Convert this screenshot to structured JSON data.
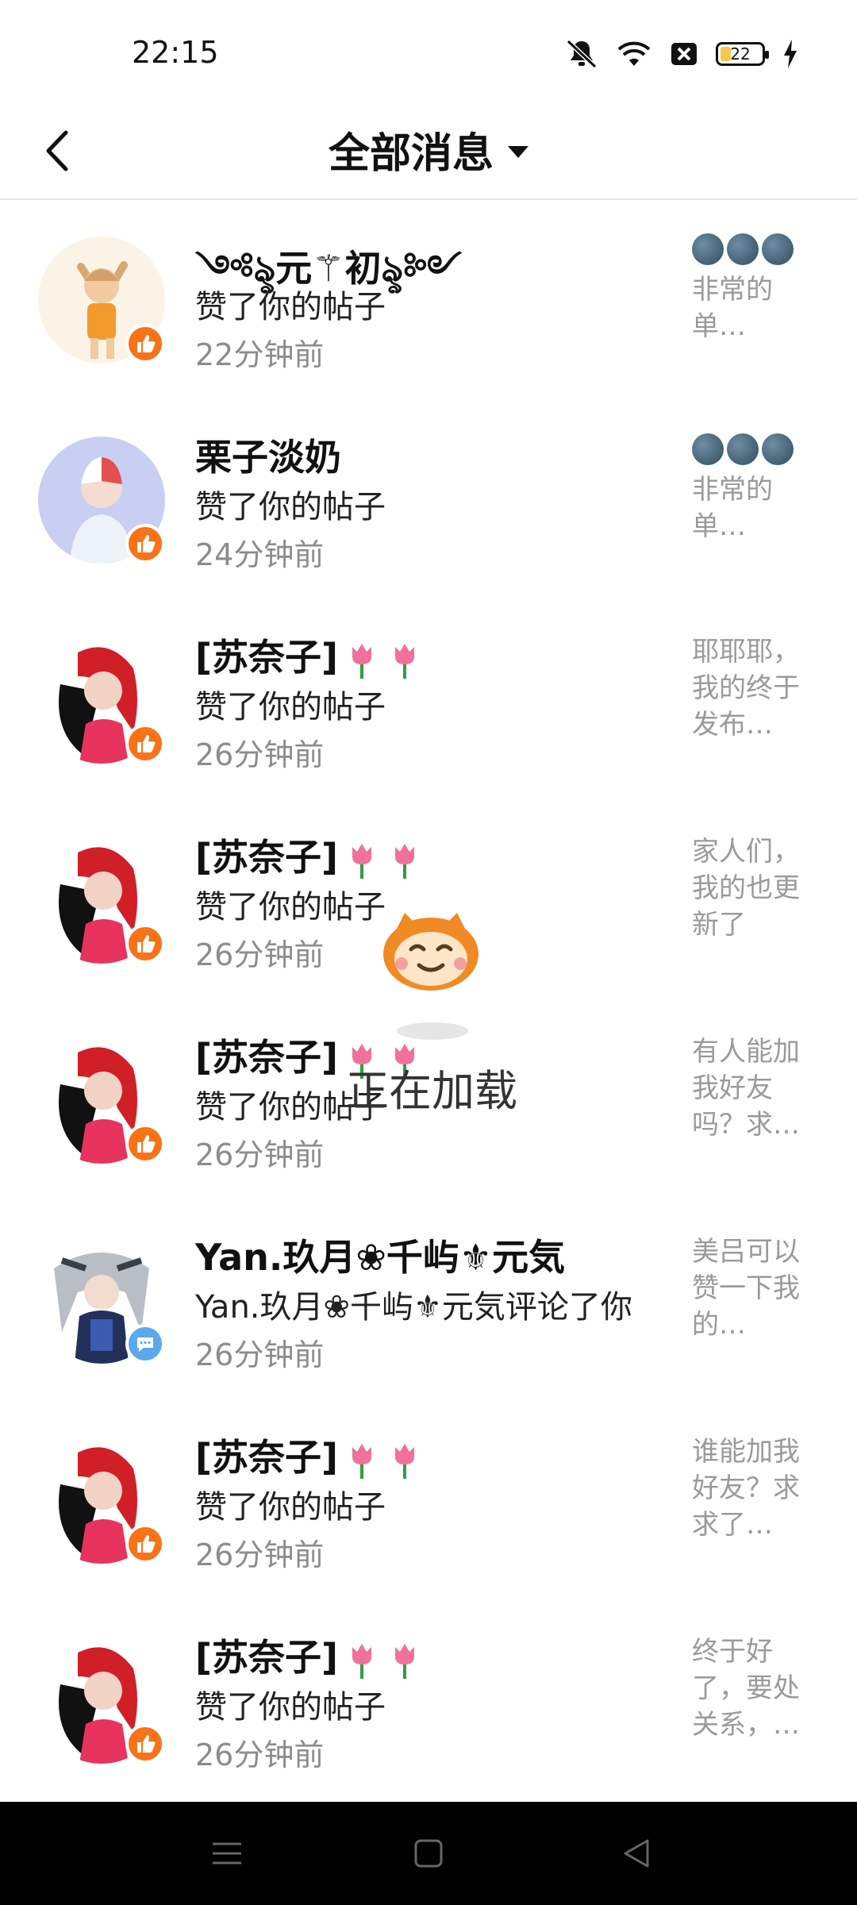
{
  "status_bar": {
    "time": "22:15",
    "battery": "22",
    "icons": [
      "mute-icon",
      "wifi-icon",
      "sim-blocked-icon",
      "battery-icon",
      "charging-icon"
    ]
  },
  "header": {
    "back_icon": "back-icon",
    "title": "全部消息",
    "dropdown_icon": "chevron-down-icon"
  },
  "messages": [
    {
      "name": "༺ৡ元⚚初ৡ༻",
      "action": "赞了你的帖子",
      "time": "22分钟前",
      "badge": "like",
      "preview_emoji": "moons",
      "preview": "非常的单…"
    },
    {
      "name": "栗子淡奶",
      "action": "赞了你的帖子",
      "time": "24分钟前",
      "badge": "like",
      "preview_emoji": "moons",
      "preview": "非常的单…"
    },
    {
      "name": "[苏奈子]",
      "action": "赞了你的帖子",
      "time": "26分钟前",
      "badge": "like",
      "preview": "耶耶耶，我的终于发布…"
    },
    {
      "name": "[苏奈子]",
      "action": "赞了你的帖子",
      "time": "26分钟前",
      "badge": "like",
      "preview": "家人们，我的也更新了"
    },
    {
      "name": "[苏奈子]",
      "action": "赞了你的帖子",
      "time": "26分钟前",
      "badge": "like",
      "preview": "有人能加我好友吗？求…"
    },
    {
      "name": "Yan.玖月❀千屿⚜元気",
      "action": "Yan.玖月❀千屿⚜元気评论了你",
      "time": "26分钟前",
      "badge": "comment",
      "preview": "美吕可以赞一下我的…"
    },
    {
      "name": "[苏奈子]",
      "action": "赞了你的帖子",
      "time": "26分钟前",
      "badge": "like",
      "preview": "谁能加我好友？求求了…"
    },
    {
      "name": "[苏奈子]",
      "action": "赞了你的帖子",
      "time": "26分钟前",
      "badge": "like",
      "preview": "终于好了，要处关系，…"
    }
  ],
  "loading": {
    "text": "正在加载",
    "mascot_icon": "monkey-mascot-icon"
  },
  "nav_bar": {
    "buttons": [
      "menu-icon",
      "home-icon",
      "back-triangle-icon"
    ]
  },
  "colors": {
    "like_badge": "#f97316",
    "comment_badge": "#5aa9ee",
    "title_text": "#111111",
    "secondary_text": "#8c8c8c"
  }
}
